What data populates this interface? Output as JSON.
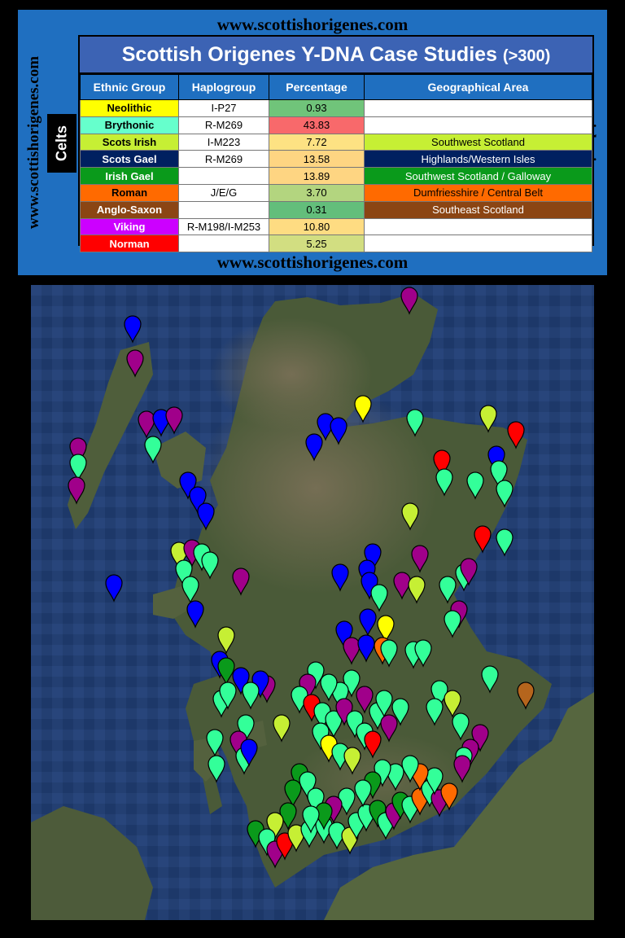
{
  "site_url": "www.scottishorigenes.com",
  "table": {
    "title": "Scottish Origenes Y-DNA Case Studies",
    "title_suffix": "(>300)",
    "side_label": "Celts",
    "headers": [
      "Ethnic Group",
      "Haplogroup",
      "Percentage",
      "Geographical Area"
    ],
    "rows": [
      {
        "group": "Neolithic",
        "haplogroup": "I-P27",
        "percentage": "0.93",
        "area": "",
        "group_color": "#ffff00",
        "group_text_color": "#000000",
        "pct_color": "#70c47a",
        "area_color": "#ffffff",
        "area_text_color": "#000000"
      },
      {
        "group": "Brythonic",
        "haplogroup": "R-M269",
        "percentage": "43.83",
        "area": "",
        "group_color": "#66ffcc",
        "group_text_color": "#000000",
        "pct_color": "#f8696b",
        "area_color": "#ffffff",
        "area_text_color": "#000000"
      },
      {
        "group": "Scots Irish",
        "haplogroup": "I-M223",
        "percentage": "7.72",
        "area": "Southwest Scotland",
        "group_color": "#c6ef34",
        "group_text_color": "#000000",
        "pct_color": "#fde283",
        "area_color": "#c6ef34",
        "area_text_color": "#000000"
      },
      {
        "group": "Scots Gael",
        "haplogroup": "R-M269",
        "percentage": "13.58",
        "area": "Highlands/Western Isles",
        "group_color": "#002060",
        "group_text_color": "#ffffff",
        "pct_color": "#fed582",
        "area_color": "#002060",
        "area_text_color": "#ffffff"
      },
      {
        "group": "Irish Gael",
        "haplogroup": "",
        "percentage": "13.89",
        "area": "Southwest Scotland / Galloway",
        "group_color": "#0a9a1b",
        "group_text_color": "#ffffff",
        "pct_color": "#fed582",
        "area_color": "#0a9a1b",
        "area_text_color": "#ffffff"
      },
      {
        "group": "Roman",
        "haplogroup": "J/E/G",
        "percentage": "3.70",
        "area": "Dumfriesshire / Central Belt",
        "group_color": "#ff6a00",
        "group_text_color": "#000000",
        "pct_color": "#b3d57f",
        "area_color": "#ff6a00",
        "area_text_color": "#000000"
      },
      {
        "group": "Anglo-Saxon",
        "haplogroup": "",
        "percentage": "0.31",
        "area": "Southeast Scotland",
        "group_color": "#8b4513",
        "group_text_color": "#ffffff",
        "pct_color": "#63be7b",
        "area_color": "#8b4513",
        "area_text_color": "#ffffff"
      },
      {
        "group": "Viking",
        "haplogroup": "R-M198/I-M253",
        "percentage": "10.80",
        "area": "",
        "group_color": "#cc00ff",
        "group_text_color": "#ffffff",
        "pct_color": "#fedc82",
        "area_color": "#ffffff",
        "area_text_color": "#000000"
      },
      {
        "group": "Norman",
        "haplogroup": "",
        "percentage": "5.25",
        "area": "",
        "group_color": "#ff0000",
        "group_text_color": "#ffffff",
        "pct_color": "#d2de81",
        "area_color": "#ffffff",
        "area_text_color": "#000000"
      }
    ]
  },
  "map": {
    "land_color": "#4a5a38",
    "highland_color": "#6b6450",
    "sea_color": "#1e3a6a",
    "marker_colors": {
      "neolithic": "#ffff00",
      "brythonic": "#33ff99",
      "scots_irish": "#c6ef34",
      "scots_gael": "#0000ff",
      "irish_gael": "#0a9a1b",
      "roman": "#ff6a00",
      "anglo_saxon": "#b5651d",
      "viking": "#a0008a",
      "norman": "#ff0000"
    }
  }
}
